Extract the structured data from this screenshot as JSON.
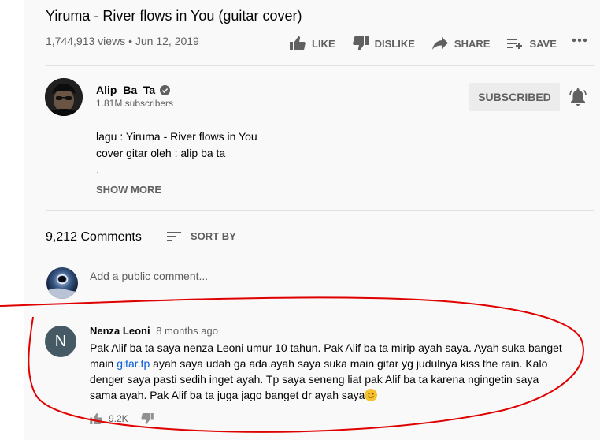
{
  "video": {
    "title": "Yiruma - River flows in You (guitar cover)",
    "views": "1,744,913 views",
    "separator": "•",
    "date": "Jun 12, 2019"
  },
  "actions": {
    "like": "LIKE",
    "dislike": "DISLIKE",
    "share": "SHARE",
    "save": "SAVE"
  },
  "channel": {
    "name": "Alip_Ba_Ta",
    "subscribers": "1.81M subscribers",
    "subscribe_label": "SUBSCRIBED"
  },
  "description": {
    "line1": "lagu : Yiruma - River flows in You",
    "line2": "cover gitar oleh : alip ba ta",
    "line3": ".",
    "show_more": "SHOW MORE"
  },
  "comments_header": {
    "count": "9,212 Comments",
    "sort_label": "SORT BY"
  },
  "add_comment": {
    "placeholder": "Add a public comment..."
  },
  "comment": {
    "avatar_letter": "N",
    "author": "Nenza Leoni",
    "time": "8 months ago",
    "text_part1": "Pak Alif ba ta saya nenza Leoni umur 10 tahun. Pak Alif ba ta mirip ayah saya. Ayah suka banget main ",
    "link_text": "gitar.tp",
    "text_part2": " ayah saya udah ga ada.ayah saya suka main gitar yg judulnya kiss the rain. Kalo denger saya pasti sedih inget ayah. Tp saya seneng liat pak Alif ba ta karena ngingetin saya sama ayah. Pak Alif ba ta juga jago banget dr ayah saya",
    "likes": "9.2K"
  },
  "colors": {
    "background": "#f9f9f9",
    "text_secondary": "#606060",
    "link": "#065fd4",
    "annotation": "#e00000"
  },
  "icons": {
    "like": "thumbs-up-icon",
    "dislike": "thumbs-down-icon",
    "share": "share-arrow-icon",
    "save": "playlist-add-icon",
    "more": "more-horizontal-icon",
    "verified": "verified-check-icon",
    "bell": "bell-icon",
    "sort": "sort-lines-icon",
    "emoji": "smiling-face-icon"
  }
}
